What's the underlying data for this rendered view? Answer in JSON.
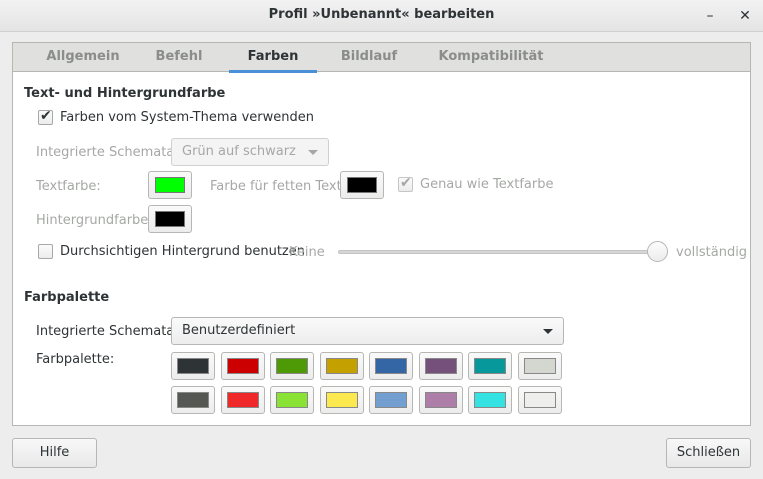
{
  "window": {
    "title": "Profil »Unbenannt« bearbeiten",
    "minimize_glyph": "–",
    "close_glyph": "✕"
  },
  "tabs": [
    {
      "label": "Allgemein",
      "active": false
    },
    {
      "label": "Befehl",
      "active": false
    },
    {
      "label": "Farben",
      "active": true
    },
    {
      "label": "Bildlauf",
      "active": false
    },
    {
      "label": "Kompatibilität",
      "active": false
    }
  ],
  "text_bg": {
    "section_title": "Text- und Hintergrundfarbe",
    "use_system_theme": {
      "label": "Farben vom System-Thema verwenden",
      "checked": true
    },
    "builtin_schemes": {
      "label": "Integrierte Schemata:",
      "value": "Grün auf schwarz"
    },
    "text_color": {
      "label": "Textfarbe:",
      "color": "#00ff00"
    },
    "bold_color": {
      "label": "Farbe für fetten Text:",
      "color": "#000000"
    },
    "same_as_text": {
      "label": "Genau wie Textfarbe",
      "checked": true
    },
    "bg_color": {
      "label": "Hintergrundfarbe:",
      "color": "#000000"
    },
    "transparent_bg": {
      "label": "Durchsichtigen Hintergrund benutzen",
      "checked": false
    },
    "slider": {
      "min_label": "Keine",
      "max_label": "vollständig",
      "value_fraction": 1.0
    }
  },
  "palette": {
    "section_title": "Farbpalette",
    "builtin_schemes": {
      "label": "Integrierte Schemata:",
      "value": "Benutzerdefiniert"
    },
    "palette_label": "Farbpalette:",
    "row1": [
      "#2e3436",
      "#cc0000",
      "#4e9a06",
      "#c4a000",
      "#3465a4",
      "#75507b",
      "#06989a",
      "#d3d7cf"
    ],
    "row2": [
      "#555753",
      "#ef2929",
      "#8ae234",
      "#fce94f",
      "#729fcf",
      "#ad7fa8",
      "#34e2e2",
      "#eeeeec"
    ]
  },
  "footer": {
    "help_label": "Hilfe",
    "close_label": "Schließen"
  }
}
